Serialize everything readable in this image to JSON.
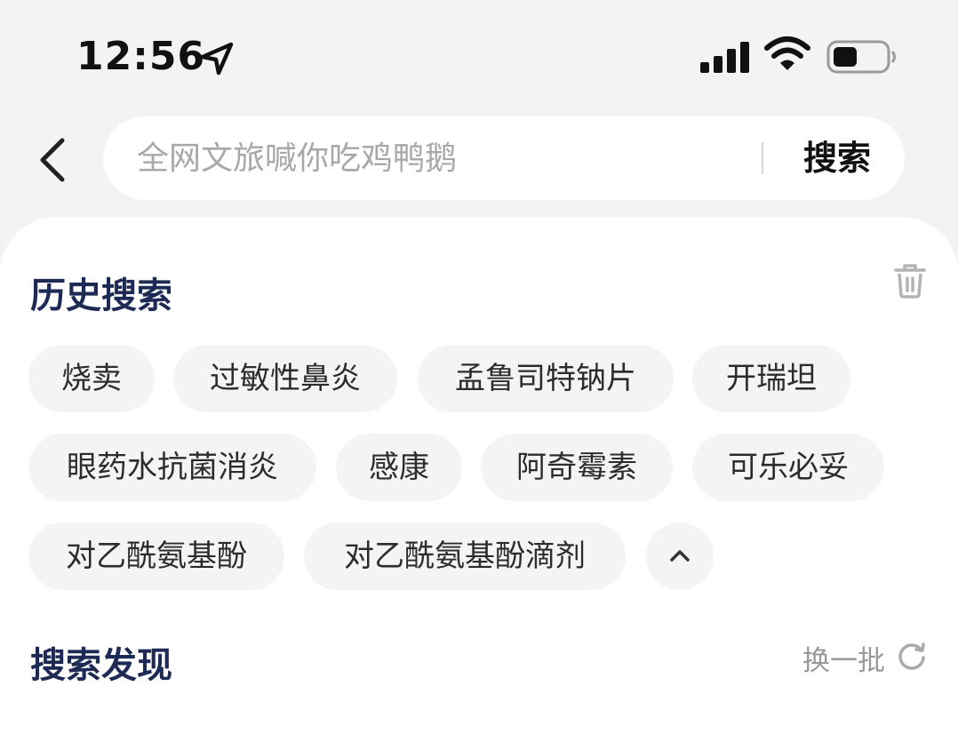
{
  "status_bar": {
    "time": "12:56",
    "icons": [
      "location-arrow-icon",
      "cellular-signal-icon",
      "wifi-icon",
      "battery-icon"
    ]
  },
  "search": {
    "placeholder": "全网文旅喊你吃鸡鸭鹅",
    "value": "",
    "button_label": "搜索"
  },
  "history": {
    "title": "历史搜索",
    "items": [
      "烧卖",
      "过敏性鼻炎",
      "孟鲁司特钠片",
      "开瑞坦",
      "眼药水抗菌消炎",
      "感康",
      "阿奇霉素",
      "可乐必妥",
      "对乙酰氨基酚",
      "对乙酰氨基酚滴剂"
    ]
  },
  "discover": {
    "title": "搜索发现",
    "refresh_label": "换一批"
  },
  "colors": {
    "page_bg": "#f3f3f3",
    "card_bg": "#ffffff",
    "chip_bg": "#f4f4f4",
    "section_title": "#1d2a55",
    "placeholder": "#a8a8a8",
    "muted": "#999999"
  }
}
